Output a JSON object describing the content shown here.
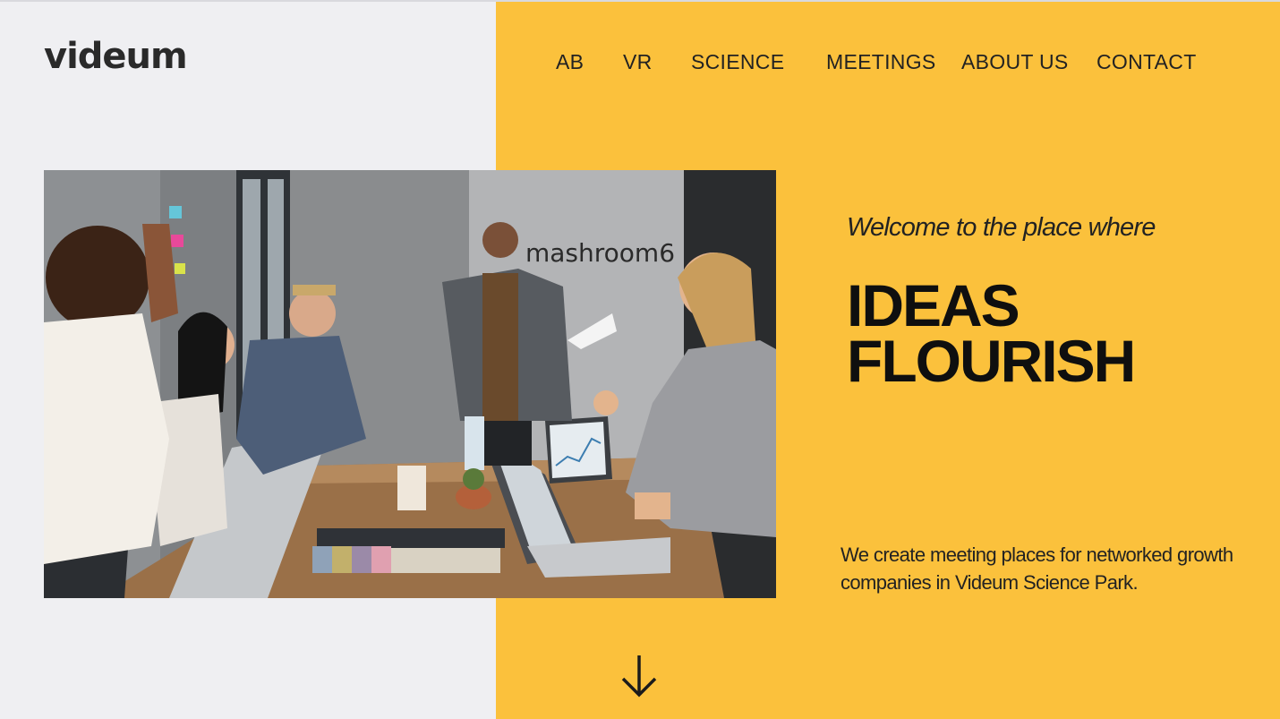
{
  "brand": {
    "name": "videum",
    "accent_color": "#f3a81c"
  },
  "nav": {
    "items": [
      {
        "label": "AB"
      },
      {
        "label": "VR"
      },
      {
        "label": "SCIENCE"
      },
      {
        "label": "MEETINGS"
      },
      {
        "label": "ABOUT US"
      },
      {
        "label": "CONTACT"
      }
    ]
  },
  "hero": {
    "photo_sign_text": "mashroom6",
    "welcome": "Welcome to the place where",
    "headline_line1": "IDEAS",
    "headline_line2": "FLOURISH",
    "description": "We create meeting places for networked growth companies in  Videum Science Park.",
    "scroll_icon": "arrow-down-icon"
  },
  "colors": {
    "left_panel": "#efeff2",
    "right_panel": "#fbc13c",
    "text": "#222222"
  }
}
